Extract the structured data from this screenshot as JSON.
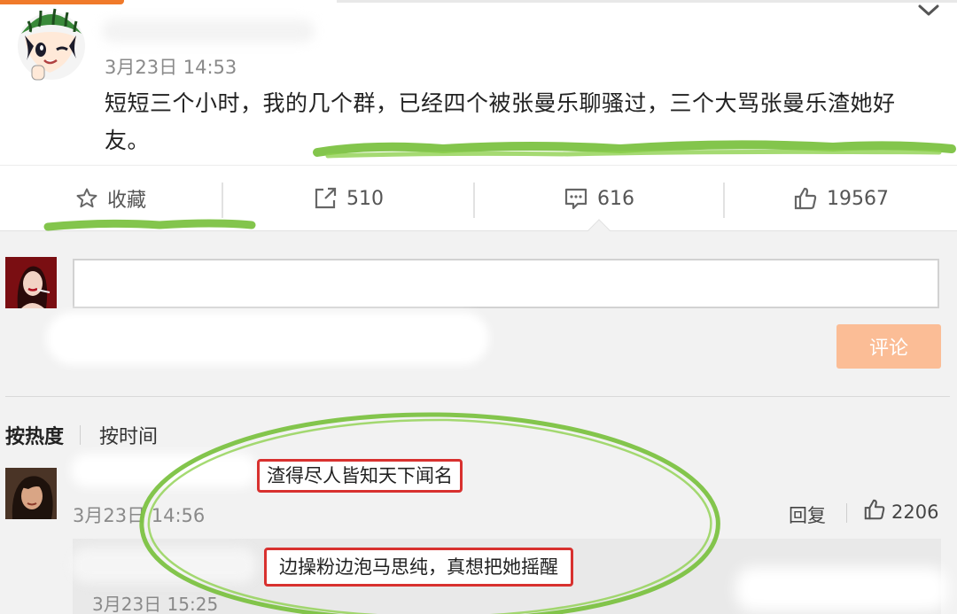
{
  "post": {
    "time": "3月23日 14:53",
    "text": "短短三个小时，我的几个群，已经四个被张曼乐聊骚过，三个大骂张曼乐渣她好友。"
  },
  "actions": {
    "favorite_label": "收藏",
    "repost_count": "510",
    "comment_count": "616",
    "like_count": "19567"
  },
  "composer": {
    "placeholder": "",
    "submit_label": "评论"
  },
  "sort": {
    "hot_label": "按热度",
    "time_label": "按时间"
  },
  "comments": [
    {
      "text": "渣得尽人皆知天下闻名",
      "time": "3月23日 14:56",
      "reply_label": "回复",
      "like_count": "2206"
    }
  ],
  "sub_comments": [
    {
      "text": "边操粉边泡马思纯，真想把她摇醒",
      "time": "3月23日 15:25"
    }
  ],
  "colors": {
    "highlight_green": "#7cc242",
    "annotation_red": "#d8312f",
    "submit_button": "#fbbd96",
    "accent_orange": "#f07a2a"
  },
  "icons": [
    "star-icon",
    "repost-icon",
    "comment-icon",
    "thumbs-up-icon",
    "chevron-down-icon"
  ]
}
